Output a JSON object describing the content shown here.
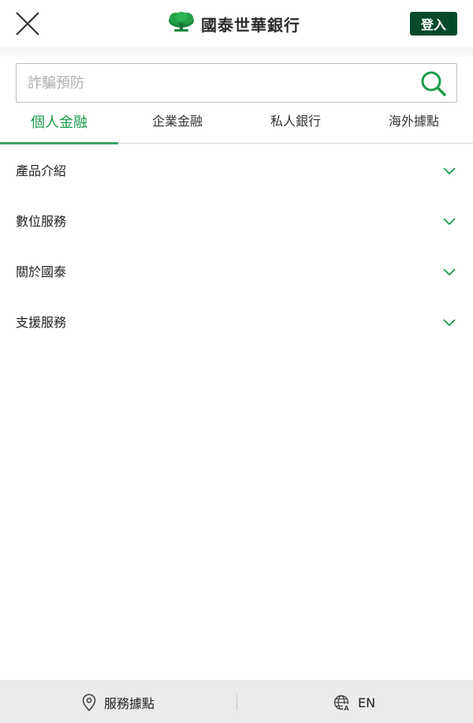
{
  "header": {
    "close_icon": "close-icon",
    "logo_text": "國泰世華銀行",
    "login_label": "登入",
    "brand_color": "#064a2c"
  },
  "search": {
    "placeholder": "詐騙預防",
    "value": "",
    "icon": "search-icon",
    "icon_color": "#1a9c4b"
  },
  "tabs": [
    {
      "label": "個人金融",
      "active": true
    },
    {
      "label": "企業金融",
      "active": false
    },
    {
      "label": "私人銀行",
      "active": false
    },
    {
      "label": "海外據點",
      "active": false
    }
  ],
  "accent_color": "#1a9c4b",
  "menu": {
    "items": [
      {
        "label": "產品介紹",
        "icon": "chevron-down-icon"
      },
      {
        "label": "數位服務",
        "icon": "chevron-down-icon"
      },
      {
        "label": "關於國泰",
        "icon": "chevron-down-icon"
      },
      {
        "label": "支援服務",
        "icon": "chevron-down-icon"
      }
    ]
  },
  "footer": {
    "branches_label": "服務據點",
    "branches_icon": "location-pin-icon",
    "language_label": "EN",
    "language_icon": "globe-icon"
  }
}
